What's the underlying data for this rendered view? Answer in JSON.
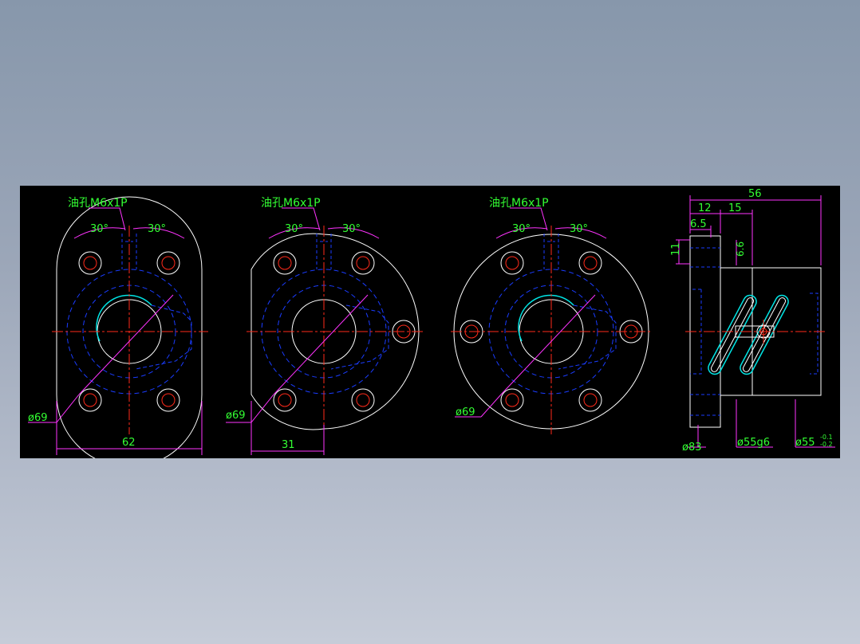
{
  "colors": {
    "background_top": "#8797ab",
    "background_bottom": "#c6ccd8",
    "canvas": "#000000",
    "outline": "#ffffff",
    "hidden_line": "#1a3cff",
    "center_line": "#ff2a1a",
    "dimension_line": "#ff33ff",
    "dimension_text": "#33ff33",
    "hole_circle": "#ff2a1a",
    "accent": "#00e5e5",
    "section_line": "#ff00ff"
  },
  "views": {
    "view1": {
      "oil_label": "油孔M6x1P",
      "angle_left": "30°",
      "angle_right": "30°",
      "dia_label": "ø69",
      "width_label": "62"
    },
    "view2": {
      "oil_label": "油孔M6x1P",
      "angle_left": "30°",
      "angle_right": "30°",
      "dia_label": "ø69",
      "half_width_label": "31"
    },
    "view3": {
      "oil_label": "油孔M6x1P",
      "angle_left": "30°",
      "angle_right": "30°",
      "dia_label": "ø69"
    },
    "side": {
      "overall_length": "56",
      "flange_thickness": "12",
      "body_step": "15",
      "hole_offset": "6.5",
      "hole_height": "11",
      "oil_hole_dim": "6.6",
      "flange_dia": "ø83",
      "body_dia": "ø55g6",
      "tol_dia": "ø55",
      "tol_upper": "-0.1",
      "tol_lower": "-0.2"
    }
  }
}
